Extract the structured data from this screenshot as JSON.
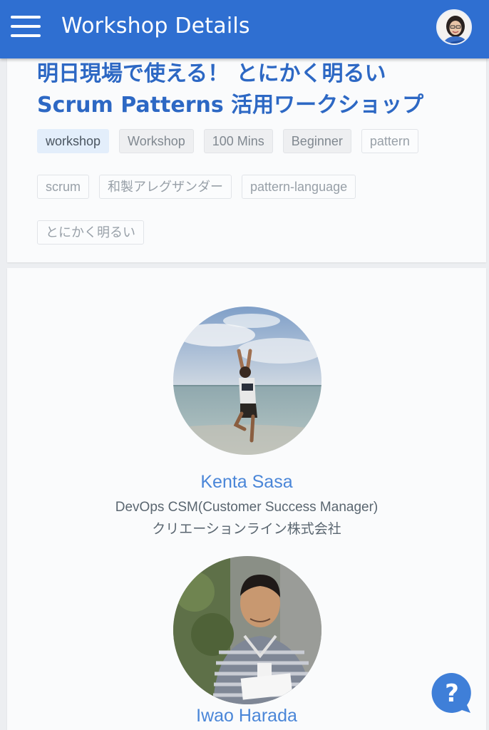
{
  "app_bar": {
    "title": "Workshop Details",
    "menu_icon": "hamburger-menu-icon",
    "user_avatar": "user-avatar-photo",
    "accent_color": "#2f6fd1"
  },
  "workshop": {
    "title_line1": "明日現場で使える！ とにかく明るい",
    "title_line2": "Scrum Patterns 活用ワークショップ",
    "tags": [
      {
        "label": "workshop",
        "style": "selected"
      },
      {
        "label": "Workshop",
        "style": "filled"
      },
      {
        "label": "100 Mins",
        "style": "filled"
      },
      {
        "label": "Beginner",
        "style": "filled"
      },
      {
        "label": "pattern",
        "style": "outline"
      },
      {
        "label": "scrum",
        "style": "outline"
      },
      {
        "label": "和製アレグザンダー",
        "style": "outline"
      },
      {
        "label": "pattern-language",
        "style": "outline"
      },
      {
        "label": "とにかく明るい",
        "style": "outline"
      }
    ]
  },
  "speakers": [
    {
      "name": "Kenta Sasa",
      "role": "DevOps CSM(Customer Success Manager)",
      "company": "クリエーションライン株式会社"
    },
    {
      "name": "Iwao Harada"
    }
  ],
  "help": {
    "icon": "help-question-icon",
    "color": "#3f7fd8"
  }
}
